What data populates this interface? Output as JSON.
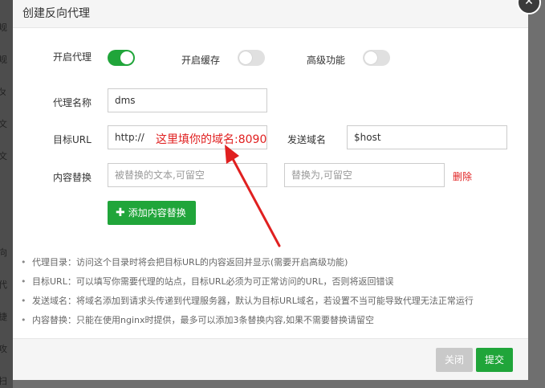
{
  "background": {
    "side_chars": [
      "规",
      "规",
      "ㄆ",
      "文",
      "文",
      "向",
      "代",
      "捷",
      "攻",
      "扫"
    ]
  },
  "dialog": {
    "title": "创建反向代理",
    "toggles": [
      {
        "label": "开启代理",
        "on": true
      },
      {
        "label": "开启缓存",
        "on": false
      },
      {
        "label": "高级功能",
        "on": false
      }
    ],
    "form": {
      "name_label": "代理名称",
      "name_value": "dms",
      "target_label": "目标URL",
      "target_value": "http://",
      "target_annotation": "这里填你的域名:8090",
      "send_domain_label": "发送域名",
      "send_domain_value": "$host",
      "replace_label": "内容替换",
      "replace_from_placeholder": "被替换的文本,可留空",
      "replace_to_placeholder": "替换为,可留空",
      "delete_label": "删除",
      "add_button_label": "添加内容替换"
    },
    "help": [
      "代理目录：访问这个目录时将会把目标URL的内容返回并显示(需要开启高级功能)",
      "目标URL：可以填写你需要代理的站点，目标URL必须为可正常访问的URL，否则将返回错误",
      "发送域名：将域名添加到请求头传递到代理服务器，默认为目标URL域名，若设置不当可能导致代理无法正常运行",
      "内容替换：只能在使用nginx时提供，最多可以添加3条替换内容,如果不需要替换请留空"
    ],
    "footer": {
      "close_label": "关闭",
      "submit_label": "提交"
    }
  },
  "colors": {
    "accent": "#20a53a",
    "annotation": "#e02020"
  }
}
